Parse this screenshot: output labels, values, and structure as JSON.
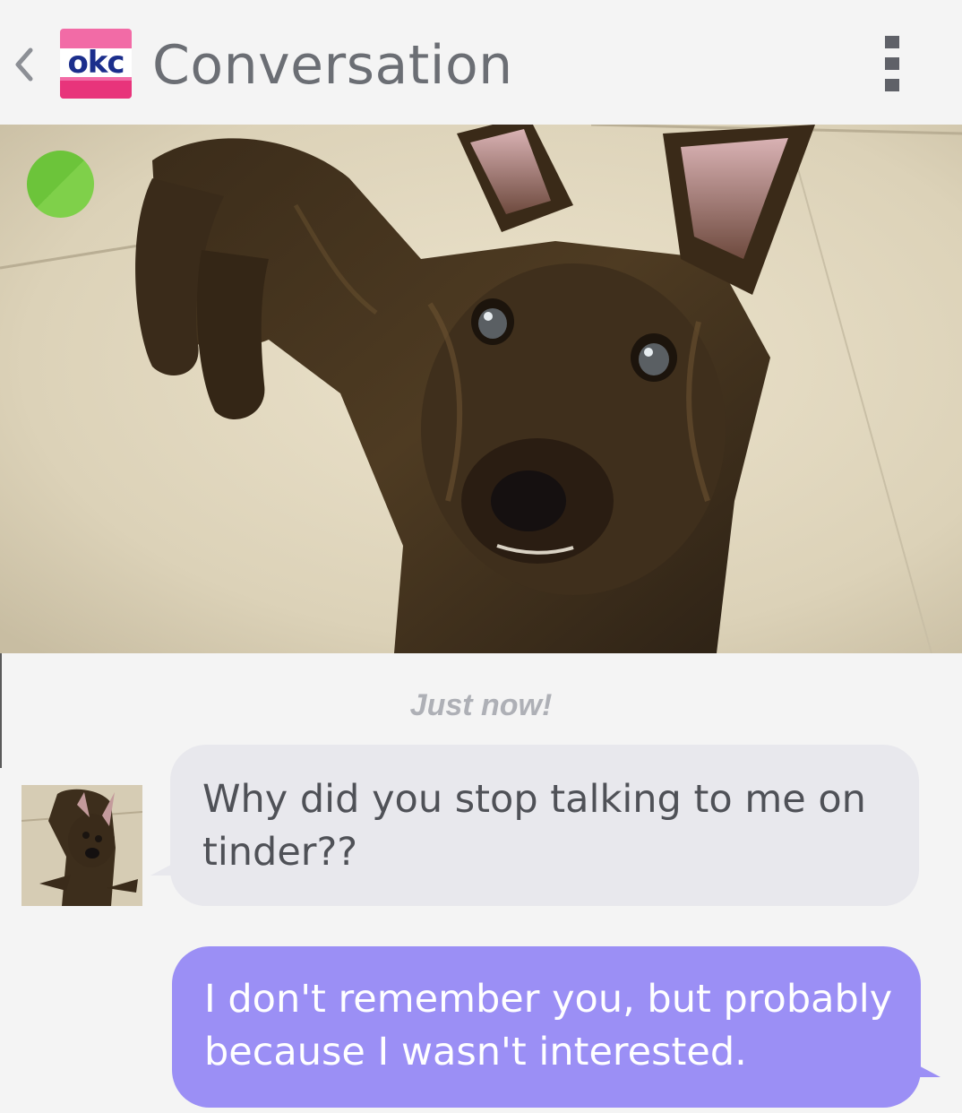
{
  "header": {
    "back_icon": "chevron-left-icon",
    "logo_text": "okc",
    "title": "Conversation",
    "menu_icon": "overflow-menu-icon"
  },
  "profile": {
    "photo_subject": "brindle-puppy-photo",
    "status_icon": "online-status-icon",
    "status_color": "#6cc43a"
  },
  "conversation": {
    "timestamp": "Just now!",
    "messages": [
      {
        "direction": "received",
        "text": "Why did you stop talking to me on tinder??"
      },
      {
        "direction": "sent",
        "text": "I don't remember you, but probably because I wasn't interested."
      }
    ]
  },
  "colors": {
    "sent_bubble": "#9b8ff5",
    "received_bubble": "#e8e8ed",
    "logo_pink": "#f26ba6",
    "logo_navy": "#1b2e8c"
  }
}
